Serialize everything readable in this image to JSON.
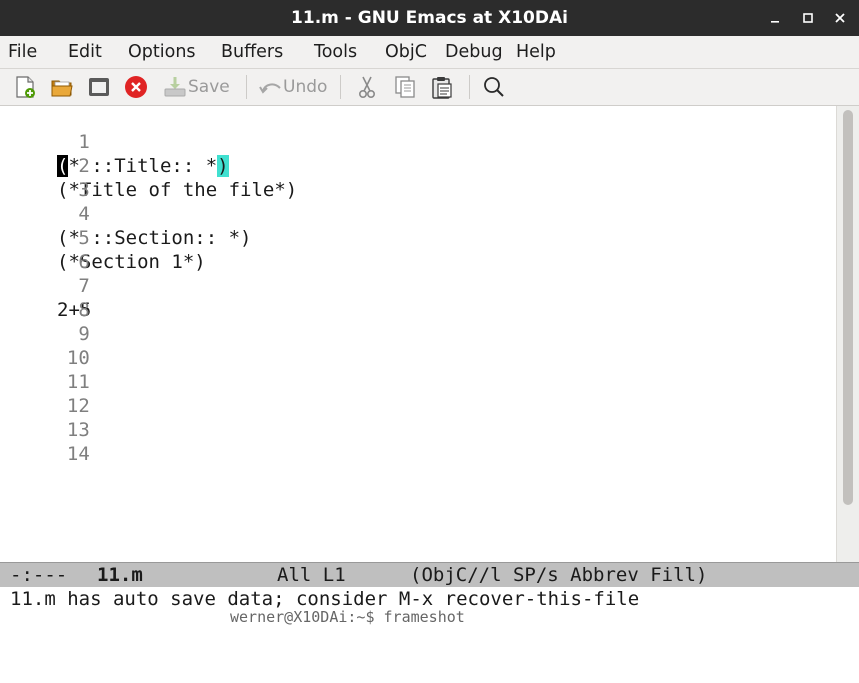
{
  "window": {
    "title": "11.m - GNU Emacs at X10DAi"
  },
  "menu": {
    "items": [
      "File",
      "Edit",
      "Options",
      "Buffers",
      "Tools",
      "ObjC",
      "Debug",
      "Help"
    ]
  },
  "toolbar": {
    "save_label": "Save",
    "undo_label": "Undo"
  },
  "editor": {
    "lines": [
      {
        "n": "1",
        "pre": "",
        "cursor": "(",
        "mid": "* ::Title:: *",
        "match": ")"
      },
      {
        "n": "2",
        "text": "(*Title of the file*)"
      },
      {
        "n": "3",
        "text": ""
      },
      {
        "n": "4",
        "text": "(* ::Section:: *)"
      },
      {
        "n": "5",
        "text": "(*Section 1*)"
      },
      {
        "n": "6",
        "text": ""
      },
      {
        "n": "7",
        "text": "2+5"
      },
      {
        "n": "8",
        "text": ""
      },
      {
        "n": "9",
        "text": ""
      },
      {
        "n": "10",
        "text": ""
      },
      {
        "n": "11",
        "text": ""
      },
      {
        "n": "12",
        "text": ""
      },
      {
        "n": "13",
        "text": ""
      },
      {
        "n": "14",
        "text": ""
      }
    ]
  },
  "modeline": {
    "status": "-:---",
    "buffer": "11.m",
    "position": "All L1",
    "modes": "(ObjC//l SP/s Abbrev Fill)"
  },
  "echo": {
    "message": "11.m has auto save data; consider M-x recover-this-file",
    "below_text": "werner@X10DAi:~$ frameshot"
  }
}
